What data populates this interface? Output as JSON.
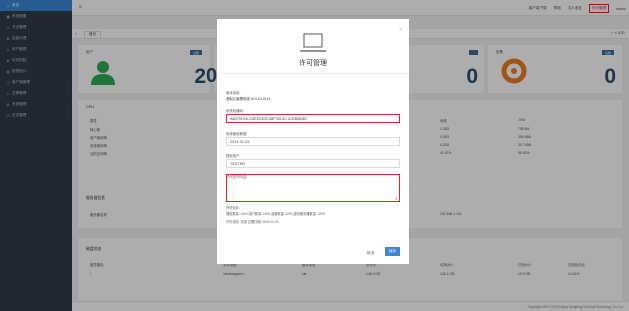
{
  "sidebar": {
    "items": [
      {
        "icon": "home-icon",
        "glyph": "⌂",
        "label": "首页",
        "active": true,
        "arrow": false
      },
      {
        "icon": "chart-icon",
        "glyph": "▣",
        "label": "系统配置",
        "active": false,
        "arrow": false
      },
      {
        "icon": "monitor-icon",
        "glyph": "▭",
        "label": "节点管理",
        "active": false,
        "arrow": false
      },
      {
        "icon": "gear-icon",
        "glyph": "⚙",
        "label": "连接代理",
        "active": false,
        "arrow": false
      },
      {
        "icon": "user-icon",
        "glyph": "☺",
        "label": "用户管理",
        "active": false,
        "arrow": false
      },
      {
        "icon": "globe-icon",
        "glyph": "⊕",
        "label": "访问控制",
        "active": false,
        "arrow": false
      },
      {
        "icon": "stats-icon",
        "glyph": "▥",
        "label": "报表统计",
        "active": false,
        "arrow": false
      },
      {
        "icon": "desktop-icon",
        "glyph": "▢",
        "label": "客户端管理",
        "active": false,
        "arrow": true
      },
      {
        "icon": "alert-icon",
        "glyph": "⚠",
        "label": "告警管理",
        "active": false,
        "arrow": true
      },
      {
        "icon": "settings-icon",
        "glyph": "⚙",
        "label": "系统管理",
        "active": false,
        "arrow": true
      },
      {
        "icon": "log-icon",
        "glyph": "☑",
        "label": "日志管理",
        "active": false,
        "arrow": true
      }
    ]
  },
  "topbar": {
    "menu_glyph": "≡",
    "download": "客户端下载",
    "help": "帮助",
    "language": "文A 语言",
    "license": "许可管理",
    "user": "admin"
  },
  "tabs": {
    "left_glyph": "«",
    "home_tab": "首页",
    "right_text": "» ⟲ 刷新"
  },
  "dashboard": {
    "card1_title": "用户",
    "card1_badge": "总数",
    "card1_value": "2",
    "card2_value": "0",
    "card3_title": "告警",
    "card3_badge": "总数",
    "card3_value": "0",
    "cpu_title": "CPU",
    "cpu_headers": [
      "属性",
      "",
      "",
      "",
      "",
      "系统",
      "JVM"
    ],
    "cpu_rows": [
      [
        "核心数",
        "",
        "",
        "",
        "",
        "1.28G",
        "799.5M"
      ],
      [
        "用户使用率",
        "",
        "",
        "",
        "",
        "0.80G",
        "396.58M"
      ],
      [
        "系统使用率",
        "",
        "",
        "",
        "",
        "4.23G",
        "317.53M"
      ],
      [
        "当前空闲率",
        "",
        "",
        "",
        "",
        "41.57%",
        "50.50%"
      ]
    ],
    "server_title": "服务器信息",
    "server_row": [
      "服务器名称",
      "192.168.1.161"
    ],
    "disk_title": "磁盘状态",
    "disk_headers": [
      "盘符路径",
      "文件系统",
      "盘符类型",
      "总大小",
      "可用大小",
      "已用大小",
      "已用百分比"
    ],
    "disk_row": [
      "/",
      "/dev/mapper/...",
      "xfs",
      "5",
      "146.0 GB",
      "126.1 GB",
      "19.9 GB",
      "13.61%"
    ]
  },
  "footer": "Copyright 2007-2023 Beijing Dongfang Vinsong Technology Co.,Ltd",
  "modal": {
    "title": "许可管理",
    "version_label": "版本信息:",
    "version_value": "虚拟云管理系统-v2.0.61.0113",
    "machine_code_label": "系统机器码:",
    "machine_code_value": "A8070F0A-D4ED0100-58F9314C-A02B8E8D",
    "expiry_label": "系统使用期限:",
    "expiry_value": "2024-01-31",
    "authorized_user_label": "授权用户:",
    "authorized_user_value": "TESTER",
    "license_text_label": "许可证书内容:",
    "info_label": "许可信息:",
    "info_line1": "授权数量: 1000  用户数量: 1000  桌面数量: 1000  虚拟服务器数量: 1000",
    "info_line2": "许可状态: 试用   过期日期: 2024-01-31",
    "cancel": "取消",
    "save": "保存"
  }
}
